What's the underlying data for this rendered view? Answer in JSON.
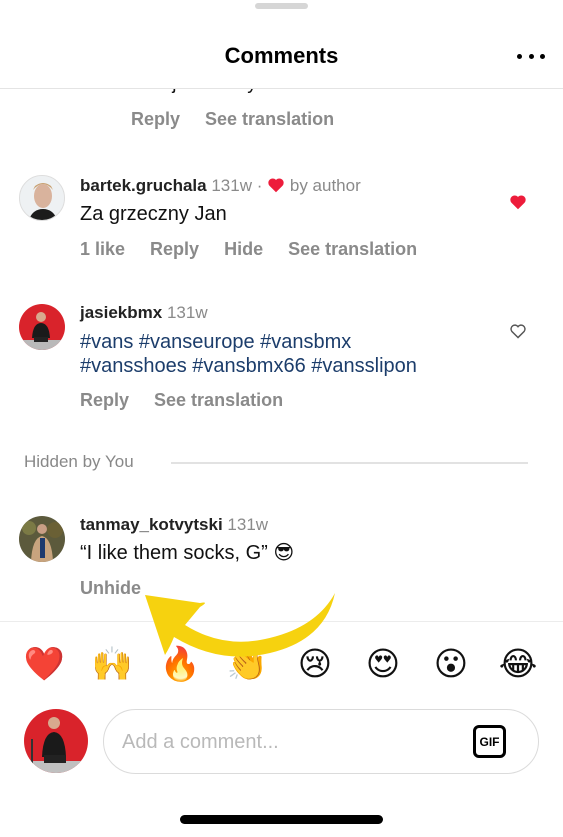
{
  "header": {
    "title": "Comments",
    "more_icon": "more-horizontal-icon"
  },
  "partial_comment": {
    "text": "dodajesz mocy",
    "actions": [
      "Reply",
      "See translation"
    ]
  },
  "comments": [
    {
      "username": "bartek.gruchala",
      "time": "131w",
      "separator": "·",
      "liked_by_author_label": "by author",
      "text": "Za grzeczny Jan",
      "actions": [
        "1 like",
        "Reply",
        "Hide",
        "See translation"
      ],
      "liked": true
    },
    {
      "username": "jasiekbmx",
      "time": "131w",
      "text_line1": "#vans #vanseurope #vansbmx",
      "text_line2": "#vansshoes #vansbmx66 #vansslipon",
      "actions": [
        "Reply",
        "See translation"
      ],
      "liked": false
    }
  ],
  "hidden_section": {
    "label": "Hidden by You",
    "comment": {
      "username": "tanmay_kotvytski",
      "time": "131w",
      "text": "“I like them socks, G”",
      "emoji": "😎",
      "action": "Unhide"
    }
  },
  "quick_reactions": [
    "❤️",
    "🙌",
    "🔥",
    "👏",
    "😢",
    "😍",
    "😮",
    "😂"
  ],
  "composer": {
    "placeholder": "Add a comment...",
    "value": "",
    "gif_label": "GIF"
  },
  "colors": {
    "like_red": "#ed1c3b",
    "hashtag_blue": "#1c3d6b",
    "annotation_yellow": "#f6d20f"
  }
}
